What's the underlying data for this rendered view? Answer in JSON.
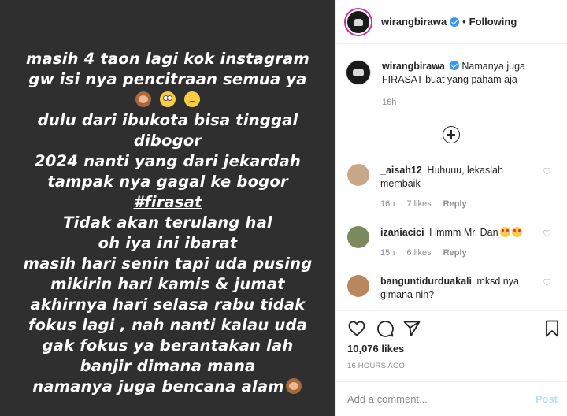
{
  "media": {
    "lines": [
      "masih 4 taon lagi kok instagram",
      "gw isi nya pencitraan semua ya",
      "dulu dari ibukota bisa tinggal",
      "dibogor",
      "2024 nanti yang dari  jekardah",
      "tampak nya gagal ke bogor",
      "#firasat",
      "Tidak akan terulang hal",
      "oh iya ini ibarat",
      "masih hari senin tapi uda pusing",
      "mikirin hari kamis & jumat",
      "akhirnya hari selasa rabu tidak",
      "fokus lagi , nah nanti kalau uda",
      "gak fokus ya berantakan lah",
      "banjir dimana mana",
      "namanya juga bencana alam"
    ],
    "emoji_row_icons": [
      "see-no-evil-monkey-icon",
      "rolling-eyes-icon",
      "disappointed-face-icon"
    ]
  },
  "header": {
    "username": "wirangbirawa",
    "separator": "•",
    "follow_status": "Following"
  },
  "caption": {
    "username": "wirangbirawa",
    "text": "Namanya juga FIRASAT buat yang paham aja",
    "time": "16h"
  },
  "comments": [
    {
      "username": "_aisah12",
      "text": "Huhuuu, lekaslah membaik",
      "time": "16h",
      "likes": "7 likes",
      "reply": "Reply",
      "avatar_color": "#c9a88a"
    },
    {
      "username": "izaniacici",
      "text": "Hmmm Mr. Dan",
      "time": "15h",
      "likes": "6 likes",
      "reply": "Reply",
      "avatar_color": "#7a8a5e"
    },
    {
      "username": "banguntidurduakali",
      "text": "mksd nya gimana nih?",
      "avatar_color": "#b8875e"
    }
  ],
  "stats": {
    "likes": "10,076 likes",
    "time_ago": "16 HOURS AGO"
  },
  "add_comment": {
    "placeholder": "Add a comment...",
    "post_label": "Post"
  },
  "colors": {
    "media_bg": "#2f2f2f",
    "verified": "#3897f0",
    "post_button": "#b2dffc",
    "muted_text": "#8e8e8e"
  }
}
